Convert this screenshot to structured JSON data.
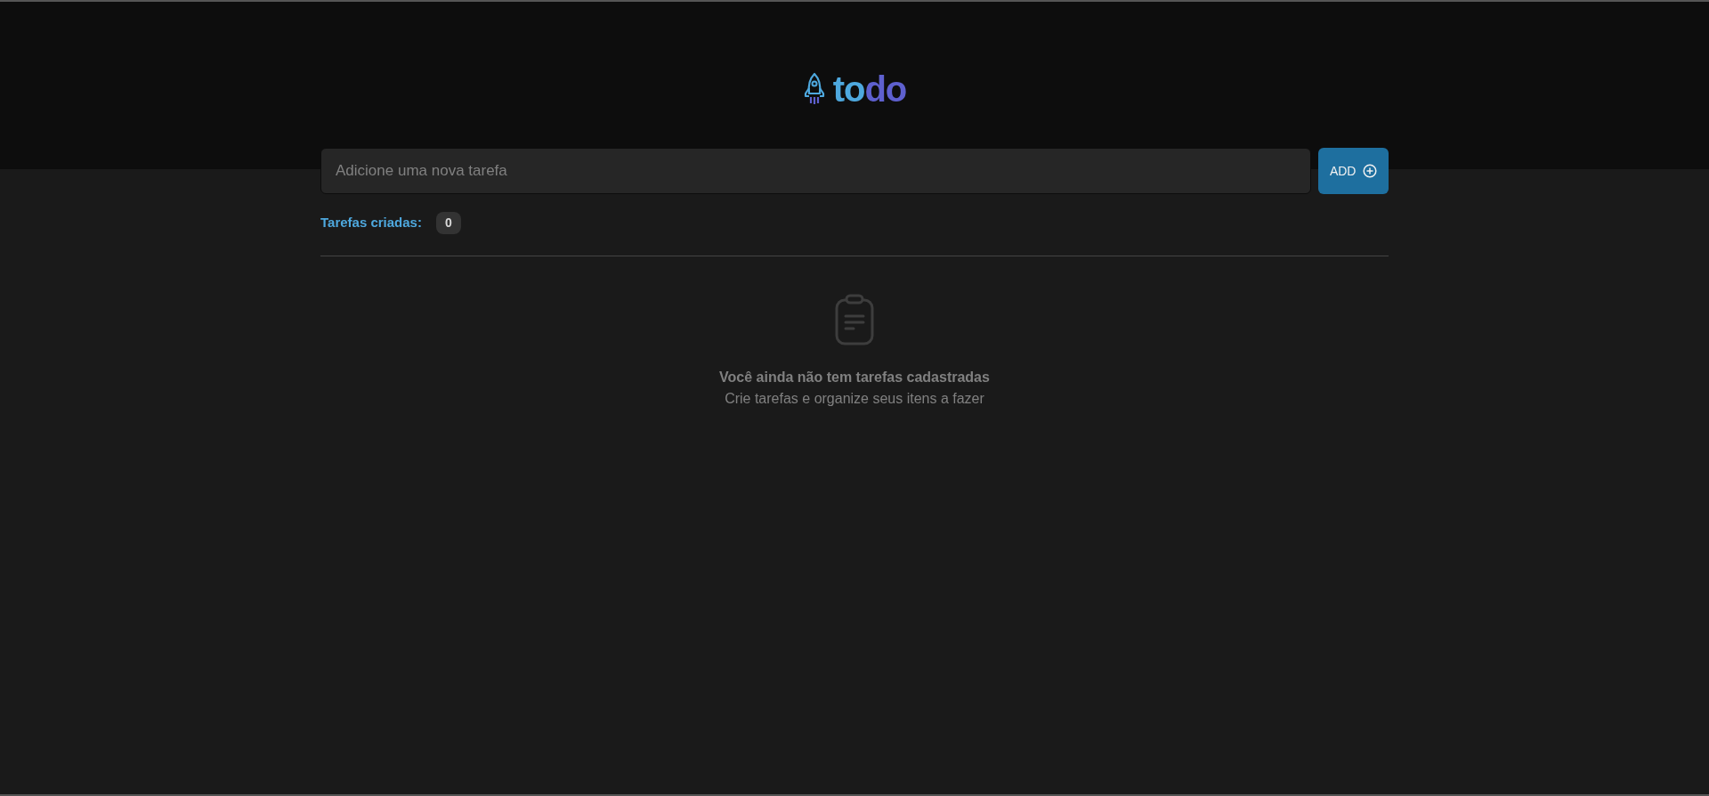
{
  "logo": {
    "parts": [
      {
        "text": "to",
        "color": "#4ea8de"
      },
      {
        "text": "do",
        "color": "#5e60ce"
      }
    ]
  },
  "new_task": {
    "placeholder": "Adicione uma nova tarefa",
    "button": "ADD"
  },
  "counter": {
    "label": "Tarefas criadas:",
    "count": "0"
  },
  "empty_state": {
    "title": "Você ainda não tem tarefas cadastradas",
    "subtitle": "Crie tarefas e organize seus itens a fazer"
  }
}
